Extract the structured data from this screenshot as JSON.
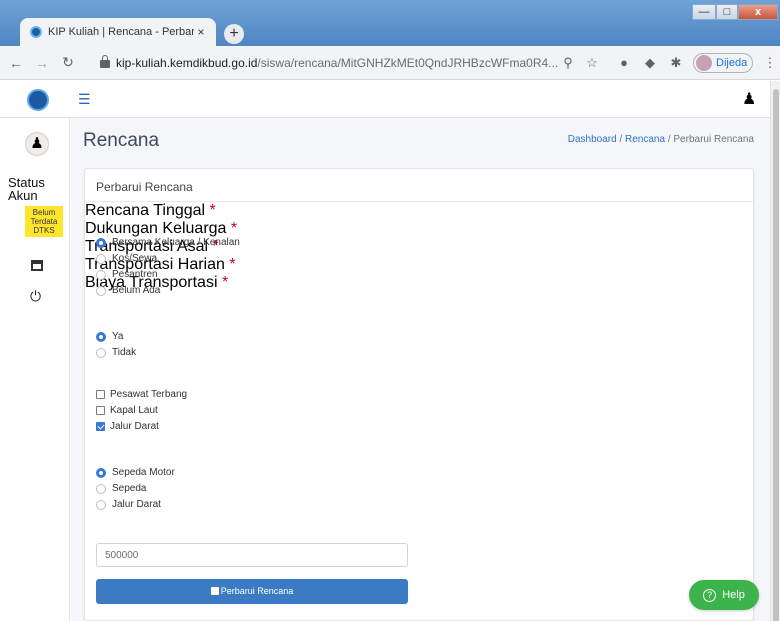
{
  "browser": {
    "tab_title": "KIP Kuliah | Rencana - Perbarui R",
    "tab_close": "×",
    "new_tab": "+",
    "win_min": "—",
    "win_max": "□",
    "win_close": "x",
    "url_host": "kip-kuliah.kemdikbud.go.id",
    "url_path": "/siswa/rencana/MitGNHZkMEt0QndJRHBzcWFma0R4...",
    "profile_name": "Dijeda"
  },
  "sidebar": {
    "status_label": "Status Akun",
    "status_badge": "Belum Terdata DTKS"
  },
  "page": {
    "title": "Rencana",
    "breadcrumb": [
      "Dashboard",
      "Rencana",
      "Perbarui Rencana"
    ],
    "breadcrumb_sep": " / "
  },
  "card": {
    "header": "Perbarui Rencana",
    "rencana_tinggal": {
      "label": "Rencana Tinggal",
      "options": [
        "Bersama Keluarga / Kenalan",
        "Kos/Sewa",
        "Pesantren",
        "Belum Ada"
      ],
      "selected": "Bersama Keluarga / Kenalan"
    },
    "dukungan_keluarga": {
      "label": "Dukungan Keluarga",
      "options": [
        "Ya",
        "Tidak"
      ],
      "selected": "Ya"
    },
    "transportasi_asal": {
      "label": "Transportasi Asal",
      "options": [
        "Pesawat Terbang",
        "Kapal Laut",
        "Jalur Darat"
      ],
      "checked": [
        "Jalur Darat"
      ]
    },
    "transportasi_harian": {
      "label": "Transportasi Harian",
      "options": [
        "Sepeda Motor",
        "Sepeda",
        "Jalur Darat"
      ],
      "selected": "Sepeda Motor"
    },
    "biaya_transportasi": {
      "label": "Biaya Transportasi",
      "value": "500000"
    },
    "required_mark": "*",
    "submit_label": "Perbarui Rencana"
  },
  "help_label": "Help",
  "colors": {
    "primary": "#3a7bc4",
    "help_green": "#3cb44b",
    "badge_yellow": "#ffe52e",
    "required_red": "#d0021b"
  }
}
